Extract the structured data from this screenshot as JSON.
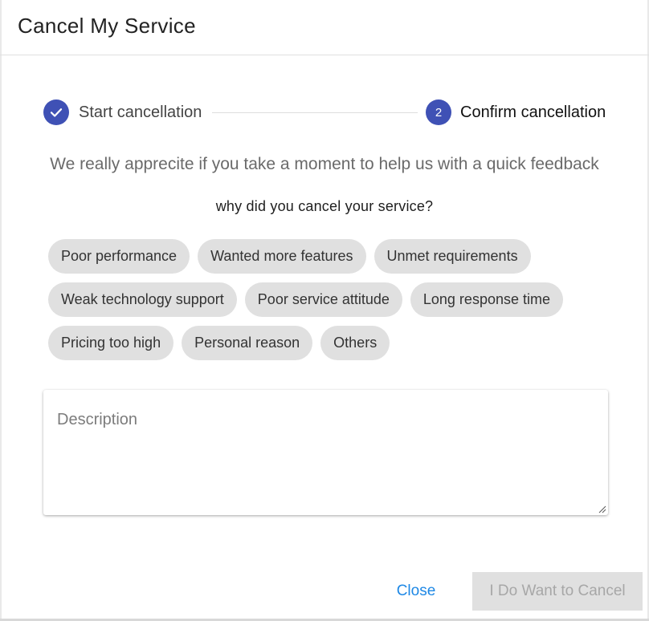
{
  "dialog": {
    "title": "Cancel My Service"
  },
  "stepper": {
    "steps": [
      {
        "label": "Start cancellation",
        "state": "completed",
        "icon": "check-icon"
      },
      {
        "label": "Confirm cancellation",
        "state": "active",
        "number": "2"
      }
    ],
    "accent_color": "#3f51b5"
  },
  "feedback": {
    "intro": "We really apprecite if you take a moment to help us with a quick feedback",
    "question": "why did you cancel your service?",
    "reasons": [
      "Poor performance",
      "Wanted more features",
      "Unmet requirements",
      "Weak technology support",
      "Poor service attitude",
      "Long response time",
      "Pricing too high",
      "Personal reason",
      "Others"
    ],
    "description_placeholder": "Description",
    "description_value": ""
  },
  "actions": {
    "close_label": "Close",
    "cancel_label": "I Do Want to Cancel",
    "close_color": "#1e88e5"
  }
}
